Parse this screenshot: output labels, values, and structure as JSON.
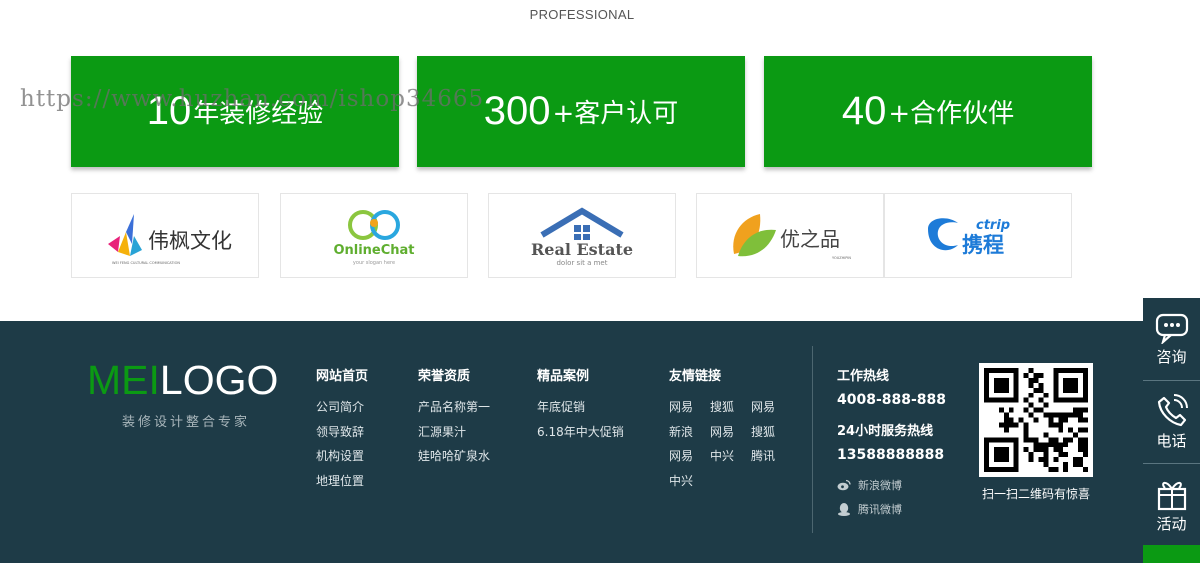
{
  "header": {
    "professional": "PROFESSIONAL"
  },
  "watermark": "https://www.huzhan.com/ishop34665",
  "stats": [
    {
      "number": "10",
      "suffix": "年装修经验"
    },
    {
      "number": "300",
      "suffix": "+客户认可"
    },
    {
      "number": "40",
      "suffix": "+合作伙伴"
    }
  ],
  "partners": [
    {
      "name": "伟枫文化",
      "sub": "WEI FENG CULTURAL COMMUNICATION"
    },
    {
      "name": "OnlineChat",
      "sub": "your slogan here"
    },
    {
      "name": "Real Estate",
      "sub": "dolor sit a met"
    },
    {
      "name": "优之品",
      "sub": "YOUZHIPIN"
    },
    {
      "name": "携程",
      "sub": "ctrip"
    }
  ],
  "footer": {
    "logo_green": "MEI",
    "logo_white": "LOGO",
    "slogan": "装修设计整合专家",
    "columns": [
      {
        "title": "网站首页",
        "items": [
          "公司简介",
          "领导致辞",
          "机构设置",
          "地理位置"
        ]
      },
      {
        "title": "荣誉资质",
        "items": [
          "产品名称第一",
          "汇源果汁",
          "娃哈哈矿泉水"
        ]
      },
      {
        "title": "精品案例",
        "items": [
          "年底促销",
          "6.18年中大促销"
        ]
      }
    ],
    "links": {
      "title": "友情链接",
      "items": [
        "网易",
        "搜狐",
        "网易",
        "新浪",
        "网易",
        "搜狐",
        "网易",
        "中兴",
        "腾讯",
        "中兴"
      ]
    },
    "hotline": {
      "title": "工作热线",
      "number": "4008-888-888",
      "title2": "24小时服务热线",
      "number2": "13588888888",
      "weibo": "新浪微博",
      "tencent": "腾讯微博"
    },
    "qr_caption": "扫一扫二维码有惊喜"
  },
  "sidebar": [
    {
      "label": "咨询",
      "icon": "chat-icon"
    },
    {
      "label": "电话",
      "icon": "phone-icon"
    },
    {
      "label": "活动",
      "icon": "gift-icon"
    }
  ],
  "colors": {
    "brand_green": "#0b9a13",
    "footer_bg": "#1e3b47"
  }
}
